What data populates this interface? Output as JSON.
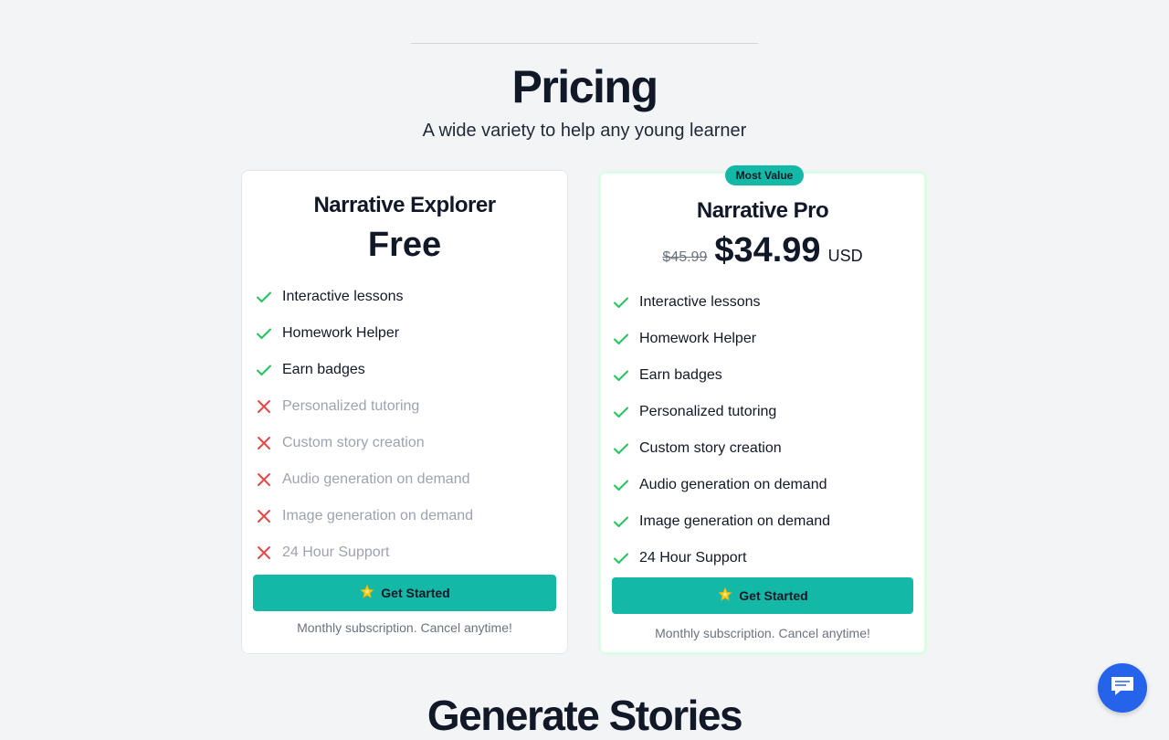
{
  "header": {
    "title": "Pricing",
    "subtitle": "A wide variety to help any young learner"
  },
  "plans": [
    {
      "name": "Narrative Explorer",
      "price": "Free",
      "features": [
        {
          "label": "Interactive lessons",
          "included": true
        },
        {
          "label": "Homework Helper",
          "included": true
        },
        {
          "label": "Earn badges",
          "included": true
        },
        {
          "label": "Personalized tutoring",
          "included": false
        },
        {
          "label": "Custom story creation",
          "included": false
        },
        {
          "label": "Audio generation on demand",
          "included": false
        },
        {
          "label": "Image generation on demand",
          "included": false
        },
        {
          "label": "24 Hour Support",
          "included": false
        }
      ],
      "cta_label": "Get Started",
      "note": "Monthly subscription. Cancel anytime!"
    },
    {
      "name": "Narrative Pro",
      "badge": "Most Value",
      "old_price": "$45.99",
      "price": "$34.99",
      "currency": "USD",
      "features": [
        {
          "label": "Interactive lessons",
          "included": true
        },
        {
          "label": "Homework Helper",
          "included": true
        },
        {
          "label": "Earn badges",
          "included": true
        },
        {
          "label": "Personalized tutoring",
          "included": true
        },
        {
          "label": "Custom story creation",
          "included": true
        },
        {
          "label": "Audio generation on demand",
          "included": true
        },
        {
          "label": "Image generation on demand",
          "included": true
        },
        {
          "label": "24 Hour Support",
          "included": true
        }
      ],
      "cta_label": "Get Started",
      "note": "Monthly subscription. Cancel anytime!"
    }
  ],
  "next_section": {
    "title": "Generate Stories"
  },
  "icons": {
    "check": "check-icon",
    "cross": "x-icon",
    "cta": "sparkle-star-icon",
    "chat": "chat-bubble-icon"
  },
  "colors": {
    "accent": "#14b8a6",
    "check": "#22c55e",
    "cross": "#ef4444",
    "chat": "#2563eb"
  }
}
